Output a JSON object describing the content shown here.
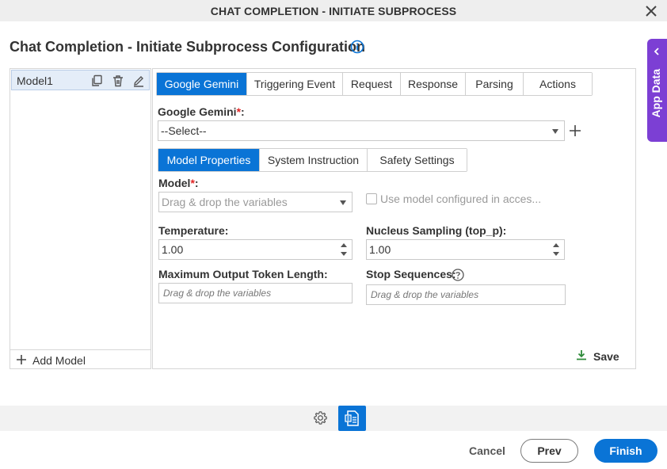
{
  "window": {
    "title": "CHAT COMPLETION - INITIATE SUBPROCESS"
  },
  "page": {
    "title": "Chat Completion - Initiate Subprocess Configuration"
  },
  "app_data_tab": {
    "label": "App Data"
  },
  "models_panel": {
    "items": [
      {
        "label": "Model1"
      }
    ],
    "add_label": "Add Model"
  },
  "main_tabs": [
    {
      "label": "Google Gemini",
      "active": true
    },
    {
      "label": "Triggering Event",
      "active": false
    },
    {
      "label": "Request",
      "active": false
    },
    {
      "label": "Response",
      "active": false
    },
    {
      "label": "Parsing",
      "active": false
    },
    {
      "label": "Actions",
      "active": false
    }
  ],
  "connection": {
    "label": "Google Gemini",
    "required_mark": "*",
    "label_suffix": ":",
    "value": "--Select--"
  },
  "sub_tabs": [
    {
      "label": "Model Properties",
      "active": true
    },
    {
      "label": "System Instruction",
      "active": false
    },
    {
      "label": "Safety Settings",
      "active": false
    }
  ],
  "model_properties": {
    "model": {
      "label": "Model",
      "required_mark": "*",
      "label_suffix": ":",
      "placeholder": "Drag & drop the variables"
    },
    "use_configured": {
      "label": "Use model configured in acces...",
      "checked": false
    },
    "temperature": {
      "label": "Temperature:",
      "value": "1.00"
    },
    "top_p": {
      "label": "Nucleus Sampling (top_p):",
      "value": "1.00"
    },
    "max_tokens": {
      "label": "Maximum Output Token Length:",
      "placeholder": "Drag & drop the variables"
    },
    "stop_sequences": {
      "label": "Stop Sequences:",
      "placeholder": "Drag & drop the variables"
    }
  },
  "save_label": "Save",
  "footer": {
    "cancel_label": "Cancel",
    "prev_label": "Prev",
    "finish_label": "Finish"
  },
  "colors": {
    "accent": "#0a74d6",
    "app_data": "#7c3fd4",
    "required": "#e02424",
    "save_icon": "#2e8b3a"
  }
}
